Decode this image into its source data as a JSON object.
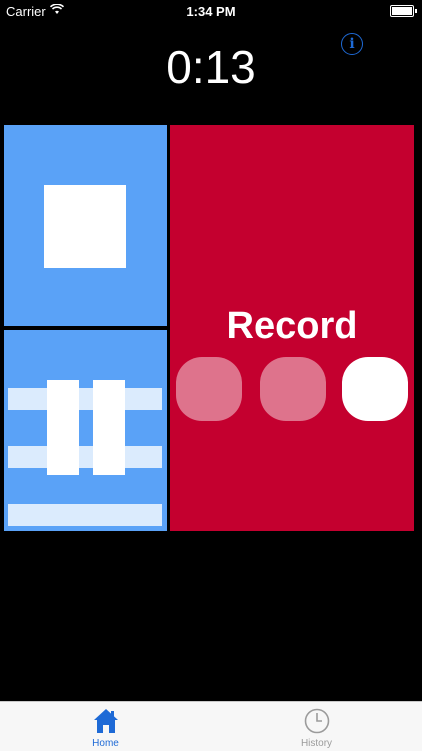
{
  "status_bar": {
    "carrier": "Carrier",
    "time": "1:34 PM",
    "wifi_icon": "wifi-icon",
    "battery_icon": "battery-icon"
  },
  "header": {
    "timer": "0:13",
    "info_icon": "info-icon",
    "info_glyph": "i"
  },
  "panels": {
    "stop": {
      "icon": "stop-icon",
      "color": "#5aa2f7"
    },
    "pause": {
      "icon": "pause-icon",
      "color": "#5aa2f7"
    },
    "record": {
      "label": "Record",
      "color": "#c4002f",
      "dots_total": 3,
      "dots_active": 1
    }
  },
  "tab_bar": {
    "tabs": [
      {
        "label": "Home",
        "icon": "home-icon",
        "selected": true,
        "color": "#1e6ad6"
      },
      {
        "label": "History",
        "icon": "clock-icon",
        "selected": false,
        "color": "#9b9b9b"
      }
    ]
  }
}
